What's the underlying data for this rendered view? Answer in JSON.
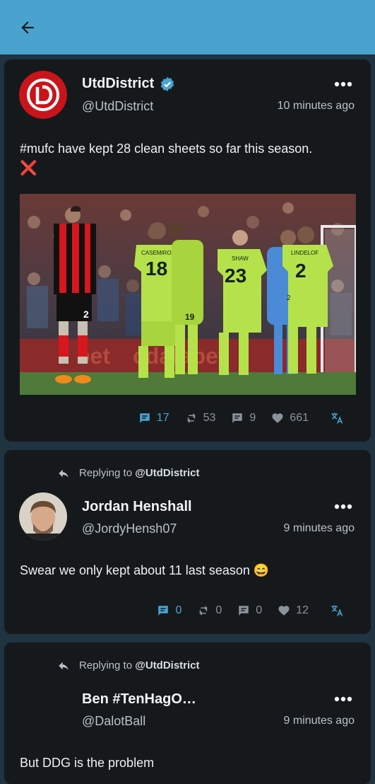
{
  "appbar": {
    "back_icon": "arrow-left-icon",
    "color": "#4aa3cf"
  },
  "posts": [
    {
      "name": "UtdDistrict",
      "handle": "@UtdDistrict",
      "time": "10 minutes ago",
      "text": "#mufc have kept 28 clean sheets so far this season.",
      "emoji": "❌",
      "image": {
        "players": [
          {
            "number": "18",
            "nameplate": "CASEMIRO"
          },
          {
            "number": "23",
            "nameplate": "SHAW"
          },
          {
            "number": "2",
            "nameplate": "LINDELOF"
          },
          {
            "number": "19",
            "nameplate": ""
          },
          {
            "number": "2",
            "nameplate": ""
          }
        ]
      },
      "stats": {
        "quotes": "17",
        "retweets": "53",
        "replies": "9",
        "likes": "661"
      }
    },
    {
      "reply_label": "Replying to",
      "reply_target": "@UtdDistrict",
      "name": "Jordan Henshall",
      "handle": "@JordyHensh07",
      "time": "9 minutes ago",
      "text": "Swear we only kept about 11 last season",
      "emoji": "😄",
      "stats": {
        "quotes": "0",
        "retweets": "0",
        "replies": "0",
        "likes": "12"
      }
    },
    {
      "reply_label": "Replying to",
      "reply_target": "@UtdDistrict",
      "name": "Ben #TenHagO…",
      "handle": "@DalotBall",
      "time": "9 minutes ago",
      "text": "But DDG is the problem"
    }
  ]
}
